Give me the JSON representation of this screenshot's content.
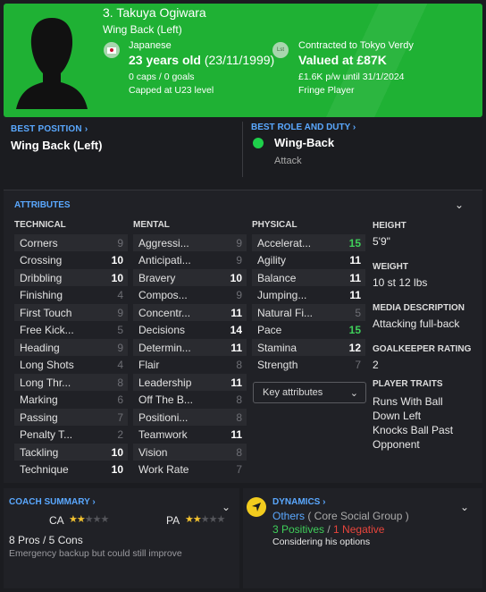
{
  "header": {
    "name": "3. Takuya Ogiwara",
    "position": "Wing Back (Left)",
    "nationality": "Japanese",
    "age": "23 years old",
    "dob": "(23/11/1999)",
    "caps": "0 caps / 0 goals",
    "capped": "Capped at U23 level",
    "club_badge": "Lst",
    "contract": "Contracted to Tokyo Verdy",
    "value": "Valued at £87K",
    "wage": "£1.6K p/w until 31/1/2024",
    "status": "Fringe Player",
    "colors": {
      "banner": "#1fb134"
    }
  },
  "best_position": {
    "title": "BEST POSITION",
    "value": "Wing Back (Left)"
  },
  "best_role": {
    "title": "BEST ROLE AND DUTY",
    "role": "Wing-Back",
    "duty": "Attack"
  },
  "attributes": {
    "title": "ATTRIBUTES",
    "technical_head": "TECHNICAL",
    "mental_head": "MENTAL",
    "physical_head": "PHYSICAL",
    "technical": [
      {
        "name": "Corners",
        "value": "9"
      },
      {
        "name": "Crossing",
        "value": "10"
      },
      {
        "name": "Dribbling",
        "value": "10"
      },
      {
        "name": "Finishing",
        "value": "4"
      },
      {
        "name": "First Touch",
        "value": "9"
      },
      {
        "name": "Free Kick...",
        "value": "5"
      },
      {
        "name": "Heading",
        "value": "9"
      },
      {
        "name": "Long Shots",
        "value": "4"
      },
      {
        "name": "Long Thr...",
        "value": "8"
      },
      {
        "name": "Marking",
        "value": "6"
      },
      {
        "name": "Passing",
        "value": "7"
      },
      {
        "name": "Penalty T...",
        "value": "2"
      },
      {
        "name": "Tackling",
        "value": "10"
      },
      {
        "name": "Technique",
        "value": "10"
      }
    ],
    "mental": [
      {
        "name": "Aggressi...",
        "value": "9"
      },
      {
        "name": "Anticipati...",
        "value": "9"
      },
      {
        "name": "Bravery",
        "value": "10"
      },
      {
        "name": "Compos...",
        "value": "9"
      },
      {
        "name": "Concentr...",
        "value": "11"
      },
      {
        "name": "Decisions",
        "value": "14"
      },
      {
        "name": "Determin...",
        "value": "11"
      },
      {
        "name": "Flair",
        "value": "8"
      },
      {
        "name": "Leadership",
        "value": "11"
      },
      {
        "name": "Off The B...",
        "value": "8"
      },
      {
        "name": "Positioni...",
        "value": "8"
      },
      {
        "name": "Teamwork",
        "value": "11"
      },
      {
        "name": "Vision",
        "value": "8"
      },
      {
        "name": "Work Rate",
        "value": "7"
      }
    ],
    "physical": [
      {
        "name": "Accelerat...",
        "value": "15"
      },
      {
        "name": "Agility",
        "value": "11"
      },
      {
        "name": "Balance",
        "value": "11"
      },
      {
        "name": "Jumping...",
        "value": "11"
      },
      {
        "name": "Natural Fi...",
        "value": "5"
      },
      {
        "name": "Pace",
        "value": "15"
      },
      {
        "name": "Stamina",
        "value": "12"
      },
      {
        "name": "Strength",
        "value": "7"
      }
    ],
    "key_attributes_label": "Key attributes"
  },
  "side": {
    "height_head": "HEIGHT",
    "height": "5'9\"",
    "weight_head": "WEIGHT",
    "weight": "10 st 12 lbs",
    "media_head": "MEDIA DESCRIPTION",
    "media": "Attacking full-back",
    "gk_head": "GOALKEEPER RATING",
    "gk": "2",
    "traits_head": "PLAYER TRAITS",
    "trait1": "Runs With Ball Down Left",
    "trait2": "Knocks Ball Past Opponent"
  },
  "coach": {
    "title": "COACH SUMMARY",
    "ca_label": "CA",
    "pa_label": "PA",
    "ca_stars": 2,
    "pa_stars": 2,
    "pros_cons": "8 Pros / 5 Cons",
    "note": "Emergency backup but could still improve"
  },
  "dynamics": {
    "title": "DYNAMICS",
    "group_link": "Others",
    "group_rest": " ( Core Social Group )",
    "positives": "3 Positives",
    "separator": " / ",
    "negatives": "1 Negative",
    "note": "Considering his options"
  }
}
